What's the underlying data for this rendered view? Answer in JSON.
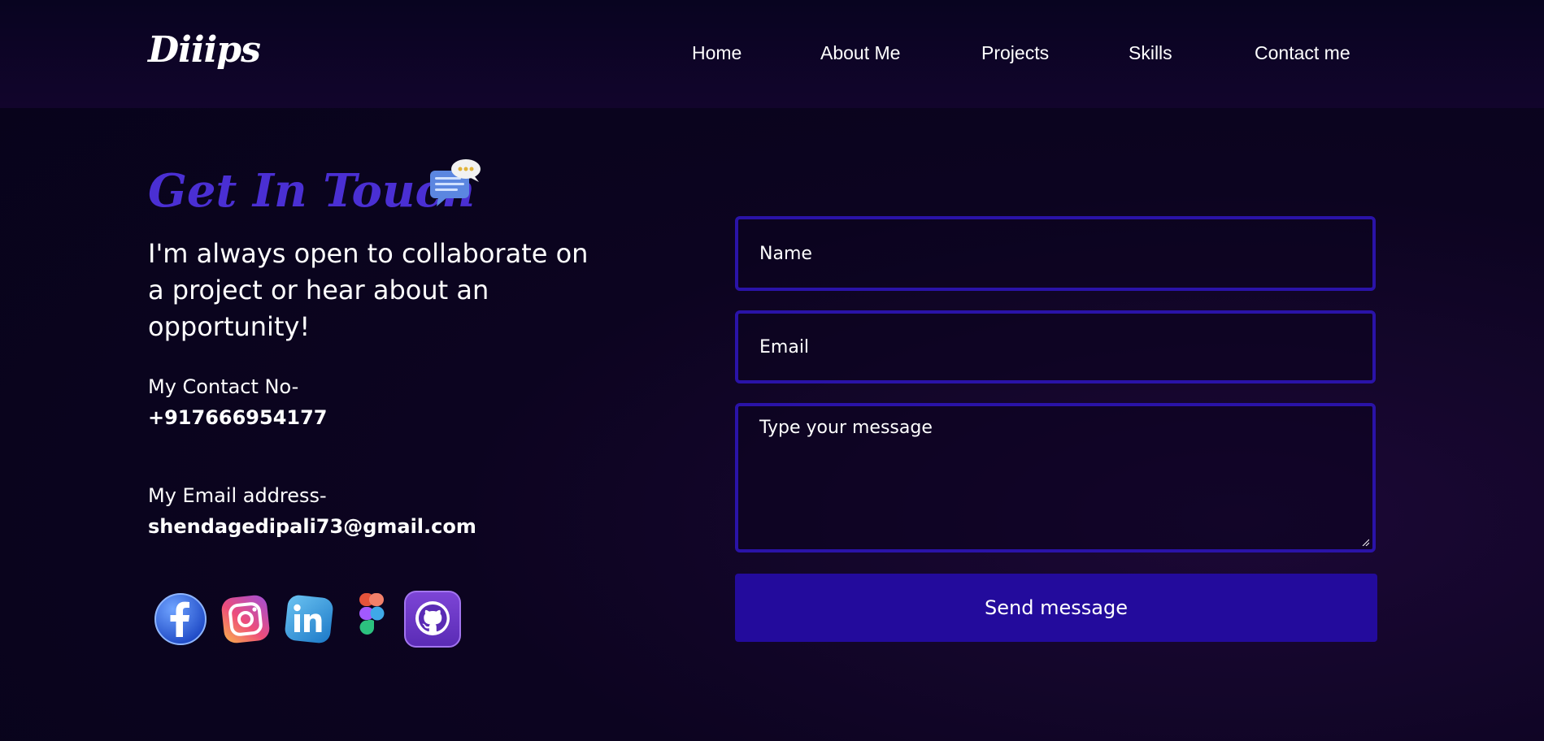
{
  "brand": {
    "logo_text": "Diiips"
  },
  "nav": {
    "items": [
      {
        "label": "Home"
      },
      {
        "label": "About Me"
      },
      {
        "label": "Projects"
      },
      {
        "label": "Skills"
      },
      {
        "label": "Contact me"
      }
    ]
  },
  "contact": {
    "heading": "Get In Touch",
    "heading_icon": "chat-bubbles-icon",
    "intro": "I'm always open to collaborate on a project or hear about an opportunity!",
    "phone_label": "My Contact No-",
    "phone_value": "+917666954177",
    "email_label": "My Email address-",
    "email_value": "shendagedipali73@gmail.com",
    "socials": [
      {
        "name": "facebook",
        "icon": "facebook-icon"
      },
      {
        "name": "instagram",
        "icon": "instagram-icon"
      },
      {
        "name": "linkedin",
        "icon": "linkedin-icon"
      },
      {
        "name": "figma",
        "icon": "figma-icon"
      },
      {
        "name": "github",
        "icon": "github-icon"
      }
    ]
  },
  "form": {
    "name_placeholder": "Name",
    "email_placeholder": "Email",
    "message_placeholder": "Type your message",
    "submit_label": "Send message"
  },
  "colors": {
    "accent": "#4a2fd3",
    "button": "#230b9c",
    "field_border": "#2a13a8",
    "background": "#07031a"
  }
}
